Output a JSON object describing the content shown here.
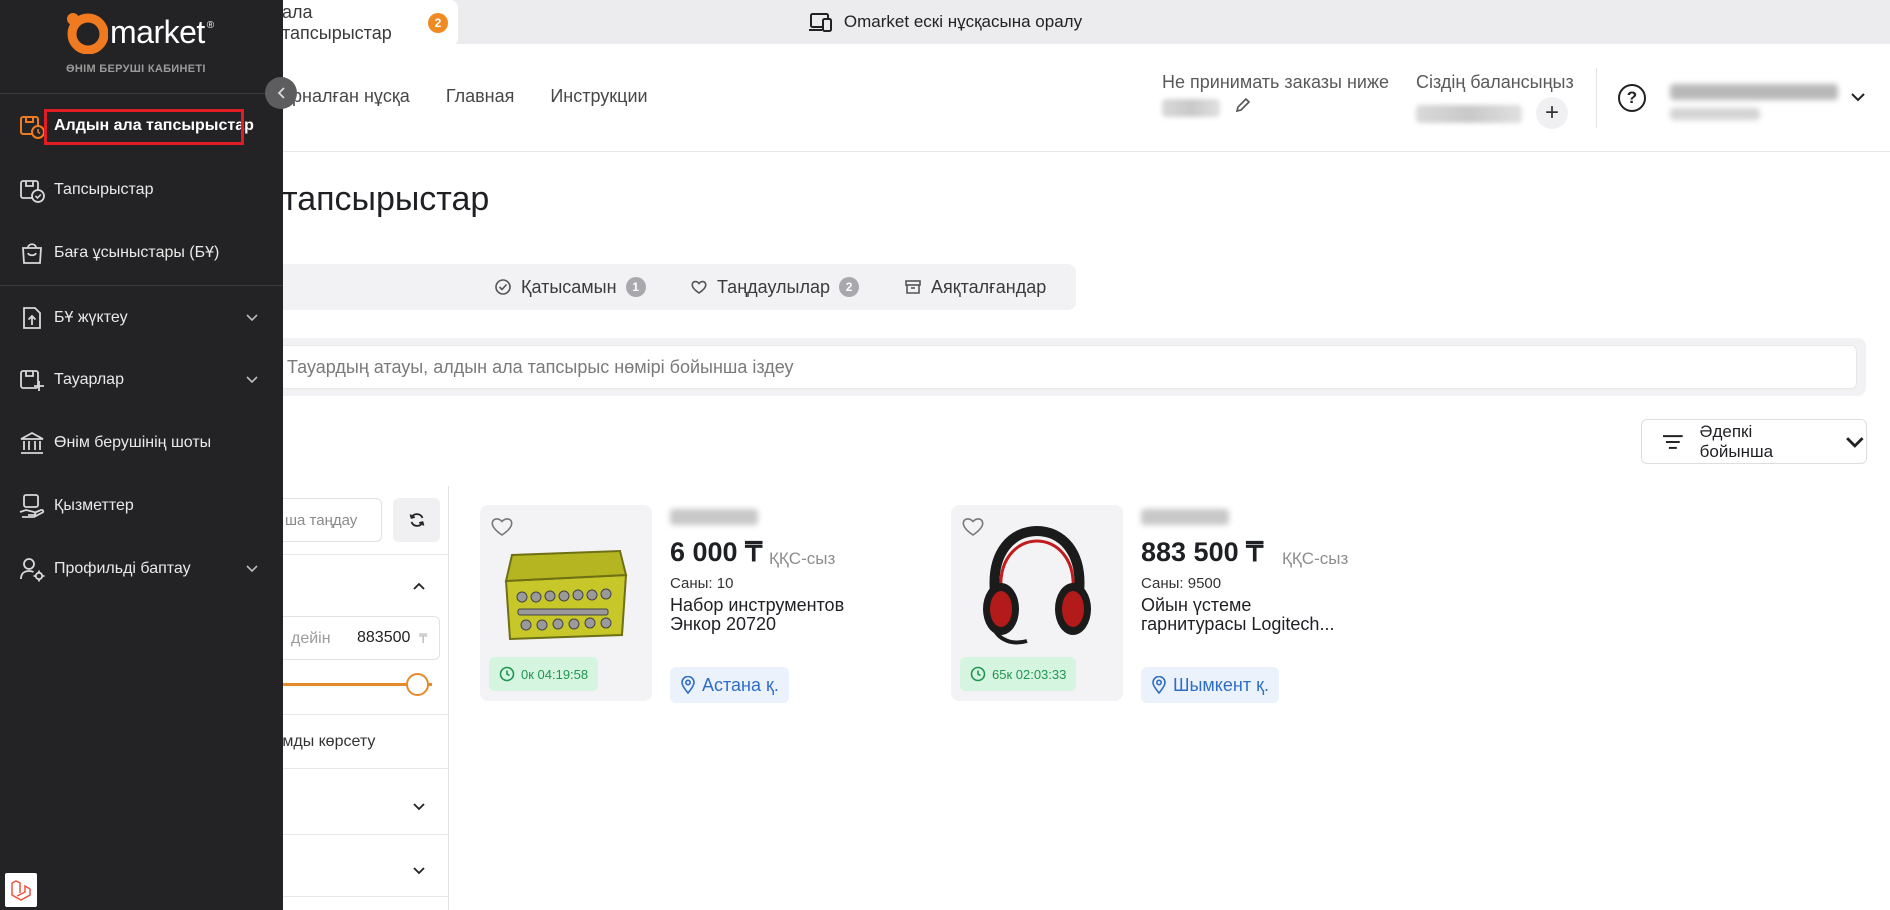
{
  "banner": {
    "text": "Omarket ескі нұсқасына оралу"
  },
  "header": {
    "nav": [
      "арналған нұсқа",
      "Главная",
      "Инструкции"
    ],
    "min_order_label": "Не принимать заказы ниже",
    "balance_label": "Сіздің балансыңыз",
    "plus_label": "+",
    "help_label": "?"
  },
  "page": {
    "title": "тапсырыстар"
  },
  "tabs": [
    {
      "label": "ала тапсырыстар",
      "count": "2"
    },
    {
      "label": "Қатысамын",
      "count": "1"
    },
    {
      "label": "Таңдаулылар",
      "count": "2"
    },
    {
      "label": "Аяқталғандар"
    }
  ],
  "search": {
    "placeholder": "Тауардың атауы, алдын ала тапсырыс нөмірі бойынша іздеу"
  },
  "sort": {
    "label": "Әдепкі бойынша"
  },
  "filters": {
    "select_placeholder": "ша таңдау",
    "range_label": "дейін",
    "range_value": "883500",
    "currency": "₸",
    "show_label": "рымды көрсету"
  },
  "products": [
    {
      "price": "6 000 ₸",
      "vat": "ҚҚС-сыз",
      "qty": "Саны: 10",
      "name_line1": "Набор инструментов",
      "name_line2": "Энкор 20720",
      "timer": "0к 04:19:58",
      "city": "Астана қ."
    },
    {
      "price": "883 500 ₸",
      "vat": "ҚҚС-сыз",
      "qty": "Саны: 9500",
      "name_line1": "Ойын үстеме",
      "name_line2": "гарнитурасы Logitech...",
      "timer": "65к 02:03:33",
      "city": "Шымкент қ."
    }
  ],
  "sidebar": {
    "logo": "market",
    "logo_mark": "®",
    "subtitle": "ӨНІМ БЕРУШІ КАБИНЕТІ",
    "items": [
      {
        "label": "Алдын ала тапсырыстар",
        "icon": "preorder-clock-icon"
      },
      {
        "label": "Тапсырыстар",
        "icon": "orders-box-icon"
      },
      {
        "label": "Баға ұсыныстары (БҰ)",
        "icon": "bag-icon"
      },
      {
        "label": "БҰ жүктеу",
        "icon": "upload-doc-icon"
      },
      {
        "label": "Тауарлар",
        "icon": "goods-add-icon"
      },
      {
        "label": "Өнім берушінің шоты",
        "icon": "bank-icon"
      },
      {
        "label": "Қызметтер",
        "icon": "services-hand-icon"
      },
      {
        "label": "Профильді баптау",
        "icon": "user-settings-icon"
      }
    ]
  },
  "colors": {
    "accent": "#f08a23",
    "sidebar_bg": "#232325",
    "highlight": "#e01c24",
    "timer_bg": "#d6f5e0",
    "city_text": "#2f6ec7"
  }
}
